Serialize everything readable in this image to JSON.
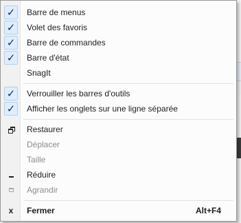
{
  "menu": {
    "items": [
      {
        "label": "Barre de menus",
        "checked": true
      },
      {
        "label": "Volet des favoris",
        "checked": true
      },
      {
        "label": "Barre de commandes",
        "checked": true
      },
      {
        "label": "Barre d'état",
        "checked": true
      },
      {
        "label": "SnagIt",
        "checked": false
      },
      {
        "label": "Verrouiller les barres d'outils",
        "checked": true
      },
      {
        "label": "Afficher les onglets sur une ligne séparée",
        "checked": true
      },
      {
        "label": "Restaurer",
        "icon": "restore-icon",
        "enabled": true
      },
      {
        "label": "Déplacer",
        "enabled": false
      },
      {
        "label": "Taille",
        "enabled": false
      },
      {
        "label": "Réduire",
        "icon": "minimize-icon",
        "enabled": true
      },
      {
        "label": "Agrandir",
        "icon": "maximize-icon",
        "enabled": false
      },
      {
        "label": "Fermer",
        "icon": "close-icon",
        "enabled": true,
        "shortcut": "Alt+F4"
      }
    ],
    "check_glyph": "✓",
    "close_glyph": "x"
  },
  "colors": {
    "check_highlight": "#dfedfa",
    "check_border": "#aecff7",
    "check_mark": "#0c2f72",
    "disabled_text": "#8d8d8d"
  }
}
